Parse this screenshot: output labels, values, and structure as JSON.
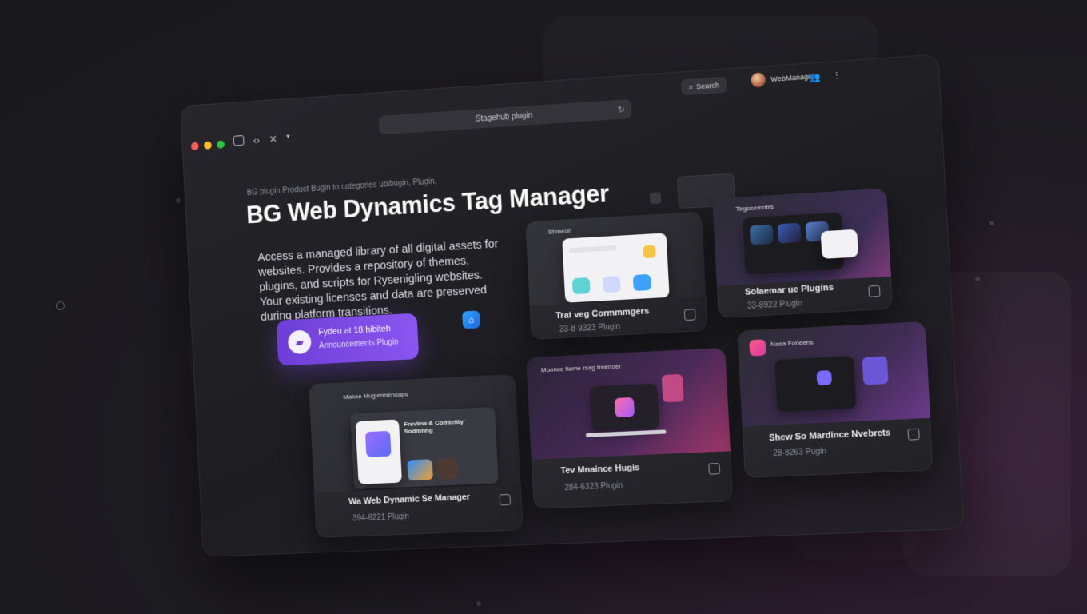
{
  "window": {
    "url": "Stagehub plugin",
    "search_label": "Search",
    "username": "WebManager"
  },
  "hero": {
    "breadcrumb": "BG plugin Product  Bugin to categories ubibugin, Plugin,",
    "title": "BG Web Dynamics Tag Manager",
    "description": "Access a managed library of all digital assets for websites. Provides a repository of themes, plugins, and scripts for Rysenigling websites. Your existing licenses and data are preserved during platform transitions.",
    "cta_title": "Fydeu at 18 hibiteh",
    "cta_subtitle": "Announcements Plugin"
  },
  "cards": [
    {
      "title": "Trat veg Cormmmgers",
      "meta": "33-8-9323 Plugin",
      "thumb_title": "Stimeon"
    },
    {
      "title": "Solaemar ue Plugins",
      "meta": "33-8922 Plugin",
      "thumb_title": "Tirgosemntrs"
    },
    {
      "title": "Wa Web Dynamic Se Manager",
      "meta": "394-6221 Plugin",
      "thumb_title": "Makee Muglermenoaps",
      "thumb_sub": "Frevlew & Comtelity' Sodmhng"
    },
    {
      "title": "Tev Mnaince Hugis",
      "meta": "284-6323 Plugin",
      "thumb_title": "Moonce fiame rsag treenoer"
    },
    {
      "title": "Shew So Mardince Nvebrets",
      "meta": "28-8263 Pugin",
      "thumb_title": "Nasa Foneens"
    }
  ],
  "colors": {
    "accent": "#7b4be6",
    "cta_gradient_start": "#6d3fd6",
    "cta_gradient_end": "#8a55f0",
    "window_bg": "#1f1f23",
    "close": "#ff5f57",
    "minimize": "#febc2e",
    "maximize": "#28c840"
  }
}
